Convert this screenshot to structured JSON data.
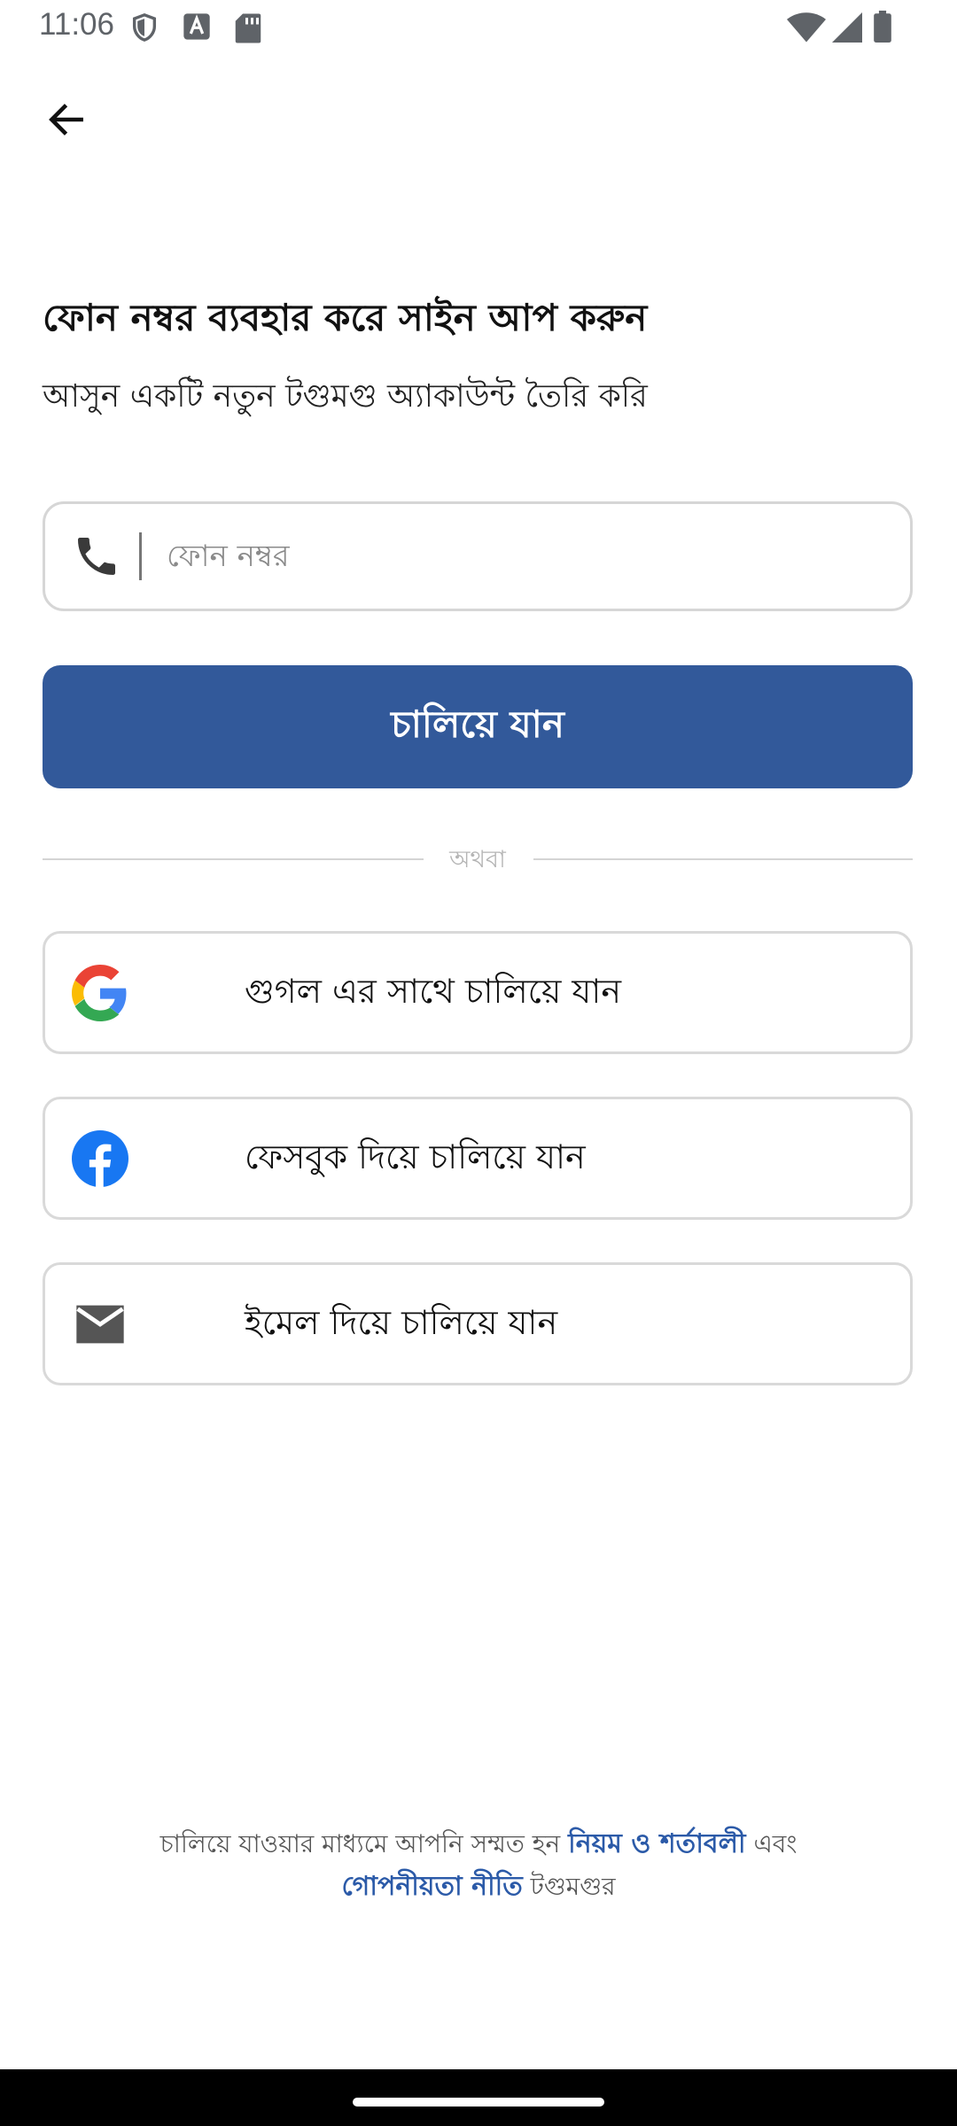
{
  "status_bar": {
    "time": "11:06",
    "icons_left": [
      "shield-icon",
      "font-a-icon",
      "sd-card-icon"
    ],
    "icons_right": [
      "wifi-icon",
      "signal-icon",
      "battery-icon"
    ]
  },
  "header": {
    "back_icon": "arrow-left-icon"
  },
  "title": "ফোন নম্বর ব্যবহার করে সাইন আপ করুন",
  "subtitle": "আসুন একটি নতুন টগুমগু অ্যাকাউন্ট তৈরি করি",
  "phone_input": {
    "placeholder": "ফোন নম্বর",
    "value": "",
    "icon": "phone-icon"
  },
  "continue_label": "চালিয়ে যান",
  "divider_text": "অথবা",
  "social": {
    "google_label": "গুগল এর সাথে চালিয়ে যান",
    "facebook_label": "ফেসবুক দিয়ে চালিয়ে যান",
    "email_label": "ইমেল দিয়ে চালিয়ে যান"
  },
  "footer": {
    "prefix": "চালিয়ে যাওয়ার মাধ্যমে আপনি সম্মত হন",
    "terms_link": "নিয়ম ও শর্তাবলী",
    "and": "এবং",
    "privacy_link": "গোপনীয়তা নীতি",
    "suffix": "টগুমগুর"
  },
  "colors": {
    "primary": "#32599a",
    "link": "#2b5aa8",
    "border": "#d9d9d9",
    "facebook": "#1877f2"
  }
}
